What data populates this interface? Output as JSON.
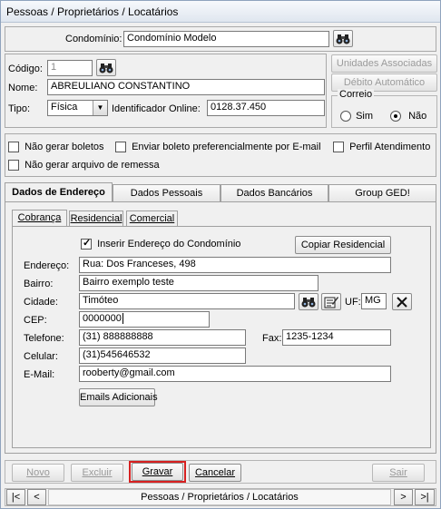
{
  "window": {
    "title": "Pessoas / Proprietários / Locatários"
  },
  "condominio": {
    "label": "Condomínio:",
    "value": "Condomínio Modelo"
  },
  "pessoa": {
    "codigo_label": "Código:",
    "codigo_value": "1",
    "nome_label": "Nome:",
    "nome_value": "ABREULIANO CONSTANTINO",
    "tipo_label": "Tipo:",
    "tipo_value": "Física",
    "identificador_label": "Identificador Online:",
    "identificador_value": "0128.37.450"
  },
  "side_buttons": {
    "unidades": "Unidades Associadas",
    "debito": "Débito Automático"
  },
  "correio": {
    "legend": "Correio",
    "sim": "Sim",
    "nao": "Não",
    "selected": "Não"
  },
  "options": {
    "nao_gerar_boletos": "Não gerar boletos",
    "enviar_boleto_email": "Enviar boleto preferencialmente por E-mail",
    "perfil_atendimento": "Perfil Atendimento",
    "nao_gerar_remessa": "Não gerar arquivo de remessa"
  },
  "tabs": [
    "Dados de Endereço",
    "Dados Pessoais",
    "Dados Bancários",
    "Group GED!"
  ],
  "subtabs": [
    "Cobrança",
    "Residencial",
    "Comercial"
  ],
  "endereco": {
    "inserir_condominio": "Inserir Endereço do Condomínio",
    "copiar_residencial": "Copiar Residencial",
    "endereco_label": "Endereço:",
    "endereco_value": "Rua: Dos Franceses, 498",
    "bairro_label": "Bairro:",
    "bairro_value": "Bairro exemplo teste",
    "cidade_label": "Cidade:",
    "cidade_value": "Timóteo",
    "uf_label": "UF:",
    "uf_value": "MG",
    "cep_label": "CEP:",
    "cep_value": "0000000",
    "telefone_label": "Telefone:",
    "telefone_value": "(31) 888888888",
    "fax_label": "Fax:",
    "fax_value": "1235-1234",
    "celular_label": "Celular:",
    "celular_value": "(31)545646532",
    "email_label": "E-Mail:",
    "email_value": "rooberty@gmail.com",
    "emails_adicionais": "Emails Adicionais"
  },
  "actions": {
    "novo": "Novo",
    "excluir": "Excluir",
    "gravar": "Gravar",
    "cancelar": "Cancelar",
    "sair": "Sair"
  },
  "navigator": {
    "first": "|<",
    "prev": "<",
    "caption": "Pessoas / Proprietários / Locatários",
    "next": ">",
    "last": ">|"
  },
  "colors": {
    "highlight": "#d62020"
  }
}
